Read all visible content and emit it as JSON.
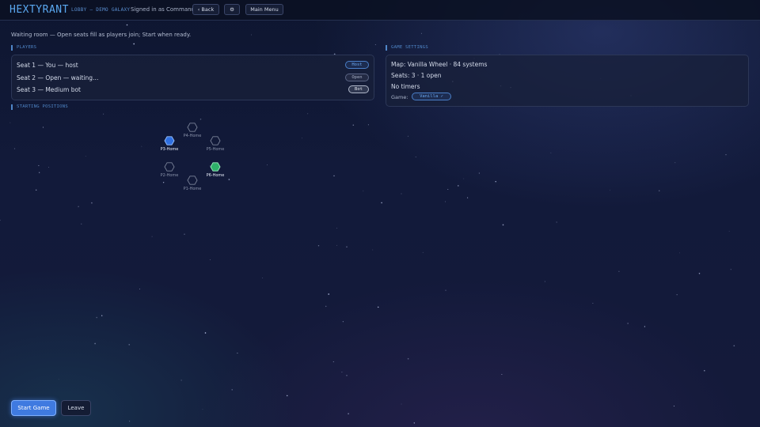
{
  "header": {
    "logo": "HEXTYRANT",
    "lobby_title": "LOBBY — DEMO GALAXY",
    "signed_in": "Signed in as Commander",
    "back_label": "‹ Back",
    "settings_icon": "gear-icon",
    "settings_glyph": "⚙",
    "main_menu_label": "Main Menu"
  },
  "status_text": "Waiting room — Open seats fill as players join; Start when ready.",
  "players": {
    "label": "PLAYERS",
    "seats": [
      {
        "text": "Seat 1 — You — host",
        "badge": "Host"
      },
      {
        "text": "Seat 2 — Open — waiting…",
        "badge": "Open"
      },
      {
        "text": "Seat 3 — Medium bot",
        "badge": "Bot"
      }
    ]
  },
  "game_settings": {
    "label": "GAME SETTINGS",
    "map": "Map: Vanilla Wheel · 84 systems",
    "seats": "Seats: 3 · 1 open",
    "timers": "No timers",
    "game_label": "Game:",
    "game_value": "Vanilla ✓"
  },
  "starting_positions": {
    "label": "STARTING POSITIONS",
    "homes": [
      {
        "label": "P4-Home",
        "state": "empty"
      },
      {
        "label": "P3-Home",
        "state": "blue"
      },
      {
        "label": "P5-Home",
        "state": "empty"
      },
      {
        "label": "P2-Home",
        "state": "empty"
      },
      {
        "label": "P6-Home",
        "state": "green"
      },
      {
        "label": "P1-Home",
        "state": "empty"
      }
    ]
  },
  "footer": {
    "start_label": "Start Game",
    "leave_label": "Leave"
  },
  "colors": {
    "accent": "#3f7ae0",
    "blue_home": "#2f6fe0",
    "green_home": "#2fb06a"
  }
}
